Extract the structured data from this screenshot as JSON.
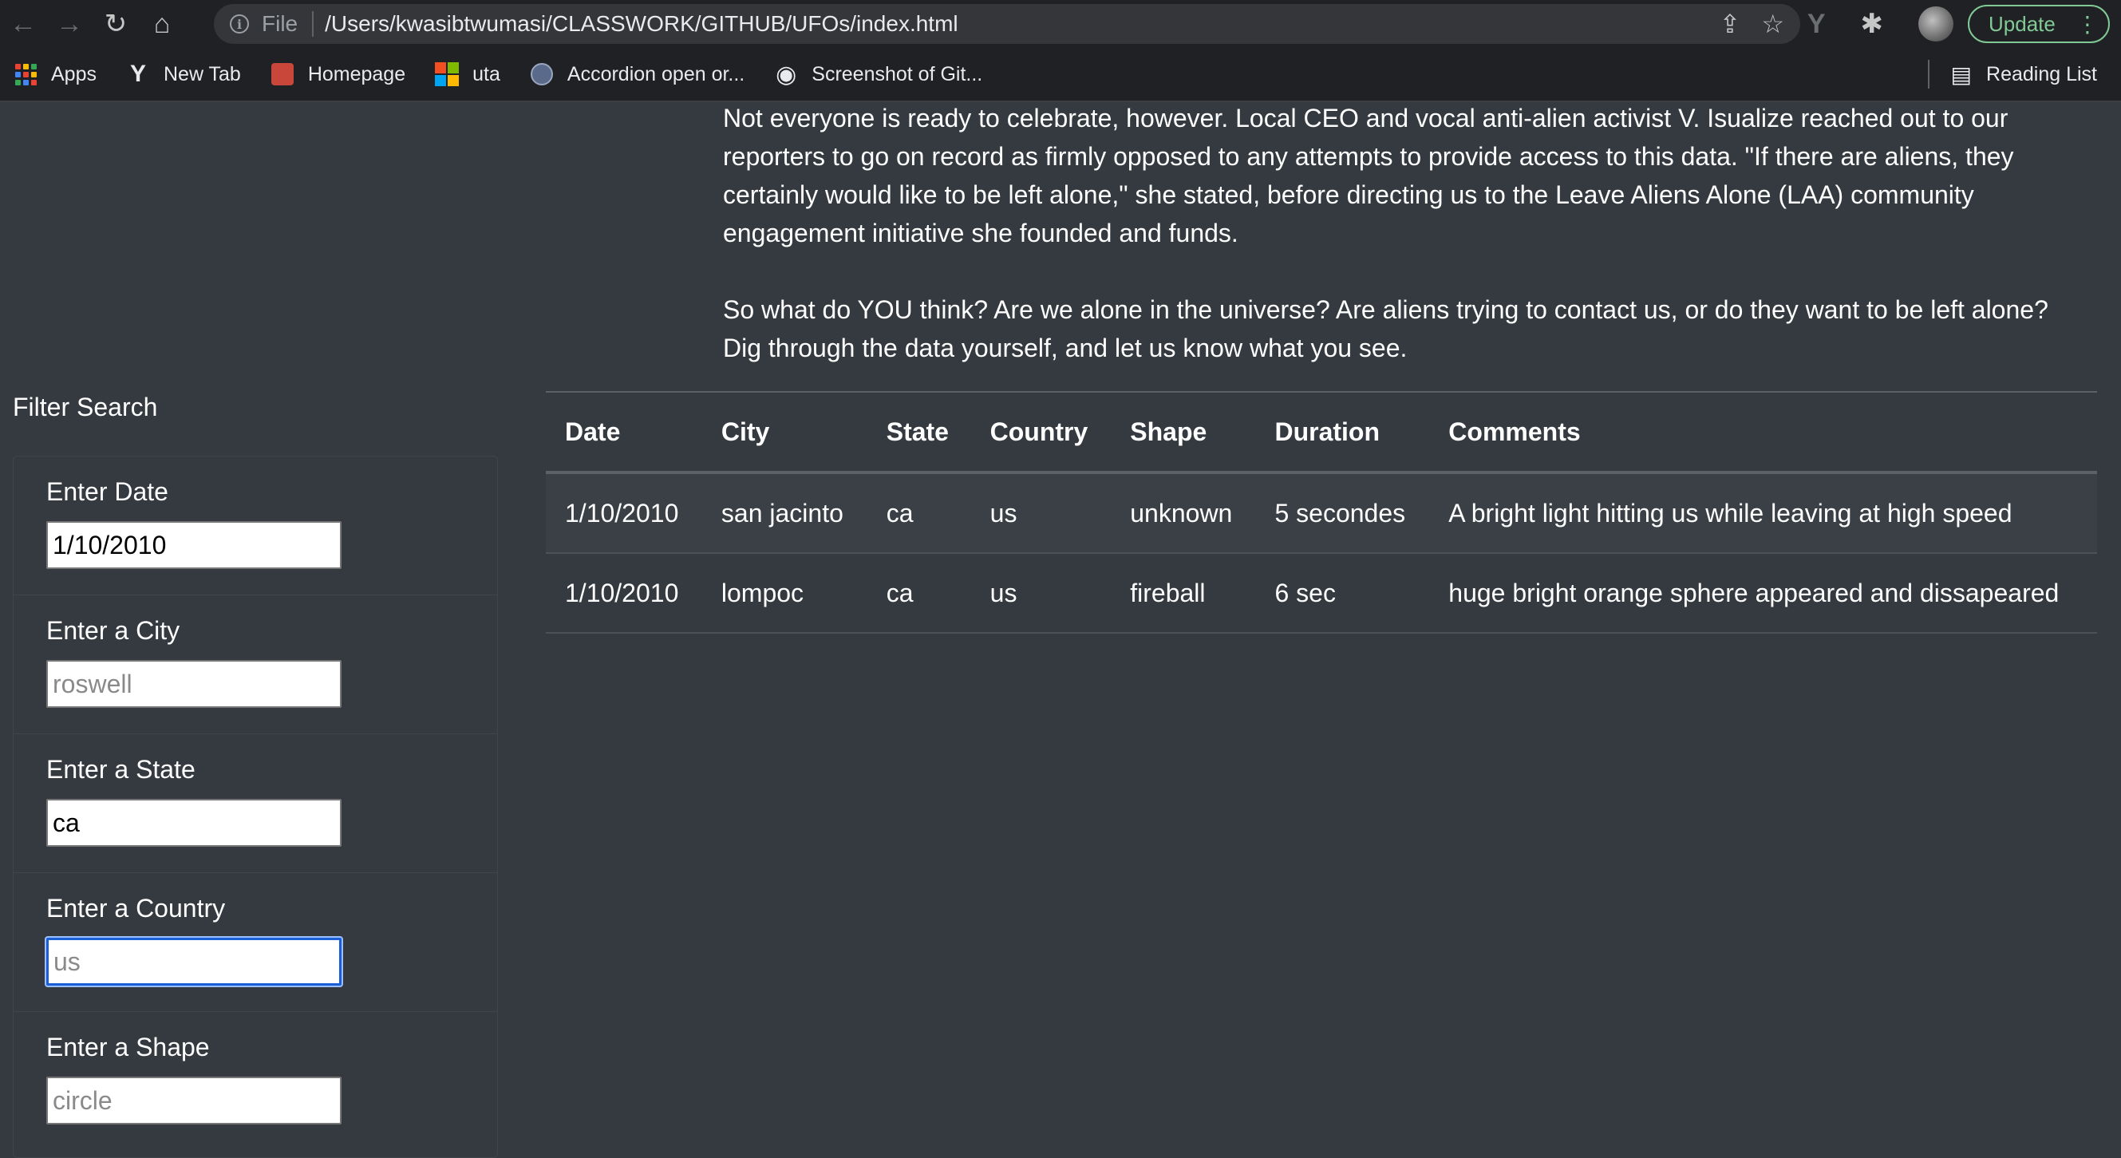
{
  "browser": {
    "scheme_label": "File",
    "url": "/Users/kwasibtwumasi/CLASSWORK/GITHUB/UFOs/index.html",
    "update_label": "Update",
    "bookmarks": [
      {
        "label": "Apps",
        "icon": "apps-grid-icon"
      },
      {
        "label": "New Tab",
        "icon": "y-logo-icon"
      },
      {
        "label": "Homepage",
        "icon": "homepage-icon"
      },
      {
        "label": "uta",
        "icon": "microsoft-logo-icon"
      },
      {
        "label": "Accordion open or...",
        "icon": "seal-icon"
      },
      {
        "label": "Screenshot of Git...",
        "icon": "globe-icon"
      }
    ],
    "reading_list_label": "Reading List"
  },
  "story": {
    "paragraph_1": "Not everyone is ready to celebrate, however. Local CEO and vocal anti-alien activist V. Isualize reached out to our reporters to go on record as firmly opposed to any attempts to provide access to this data. \"If there are aliens, they certainly would like to be left alone,\" she stated, before directing us to the Leave Aliens Alone (LAA) community engagement initiative she founded and funds.",
    "paragraph_2": "So what do YOU think? Are we alone in the universe? Are aliens trying to contact us, or do they want to be left alone? Dig through the data yourself, and let us know what you see."
  },
  "filters": {
    "title": "Filter Search",
    "date": {
      "label": "Enter Date",
      "value": "1/10/2010",
      "placeholder": ""
    },
    "city": {
      "label": "Enter a City",
      "value": "",
      "placeholder": "roswell"
    },
    "state": {
      "label": "Enter a State",
      "value": "ca",
      "placeholder": ""
    },
    "country": {
      "label": "Enter a Country",
      "value": "",
      "placeholder": "us"
    },
    "shape": {
      "label": "Enter a Shape",
      "value": "",
      "placeholder": "circle"
    }
  },
  "table": {
    "headers": [
      "Date",
      "City",
      "State",
      "Country",
      "Shape",
      "Duration",
      "Comments"
    ],
    "rows": [
      [
        "1/10/2010",
        "san jacinto",
        "ca",
        "us",
        "unknown",
        "5 secondes",
        "A bright light hitting us while leaving at high speed"
      ],
      [
        "1/10/2010",
        "lompoc",
        "ca",
        "us",
        "fireball",
        "6 sec",
        "huge bright orange sphere appeared and dissapeared"
      ]
    ]
  },
  "colors": {
    "page_background": "#343a40",
    "focus_border": "#1a5fd6",
    "update_accent": "#81c995"
  }
}
